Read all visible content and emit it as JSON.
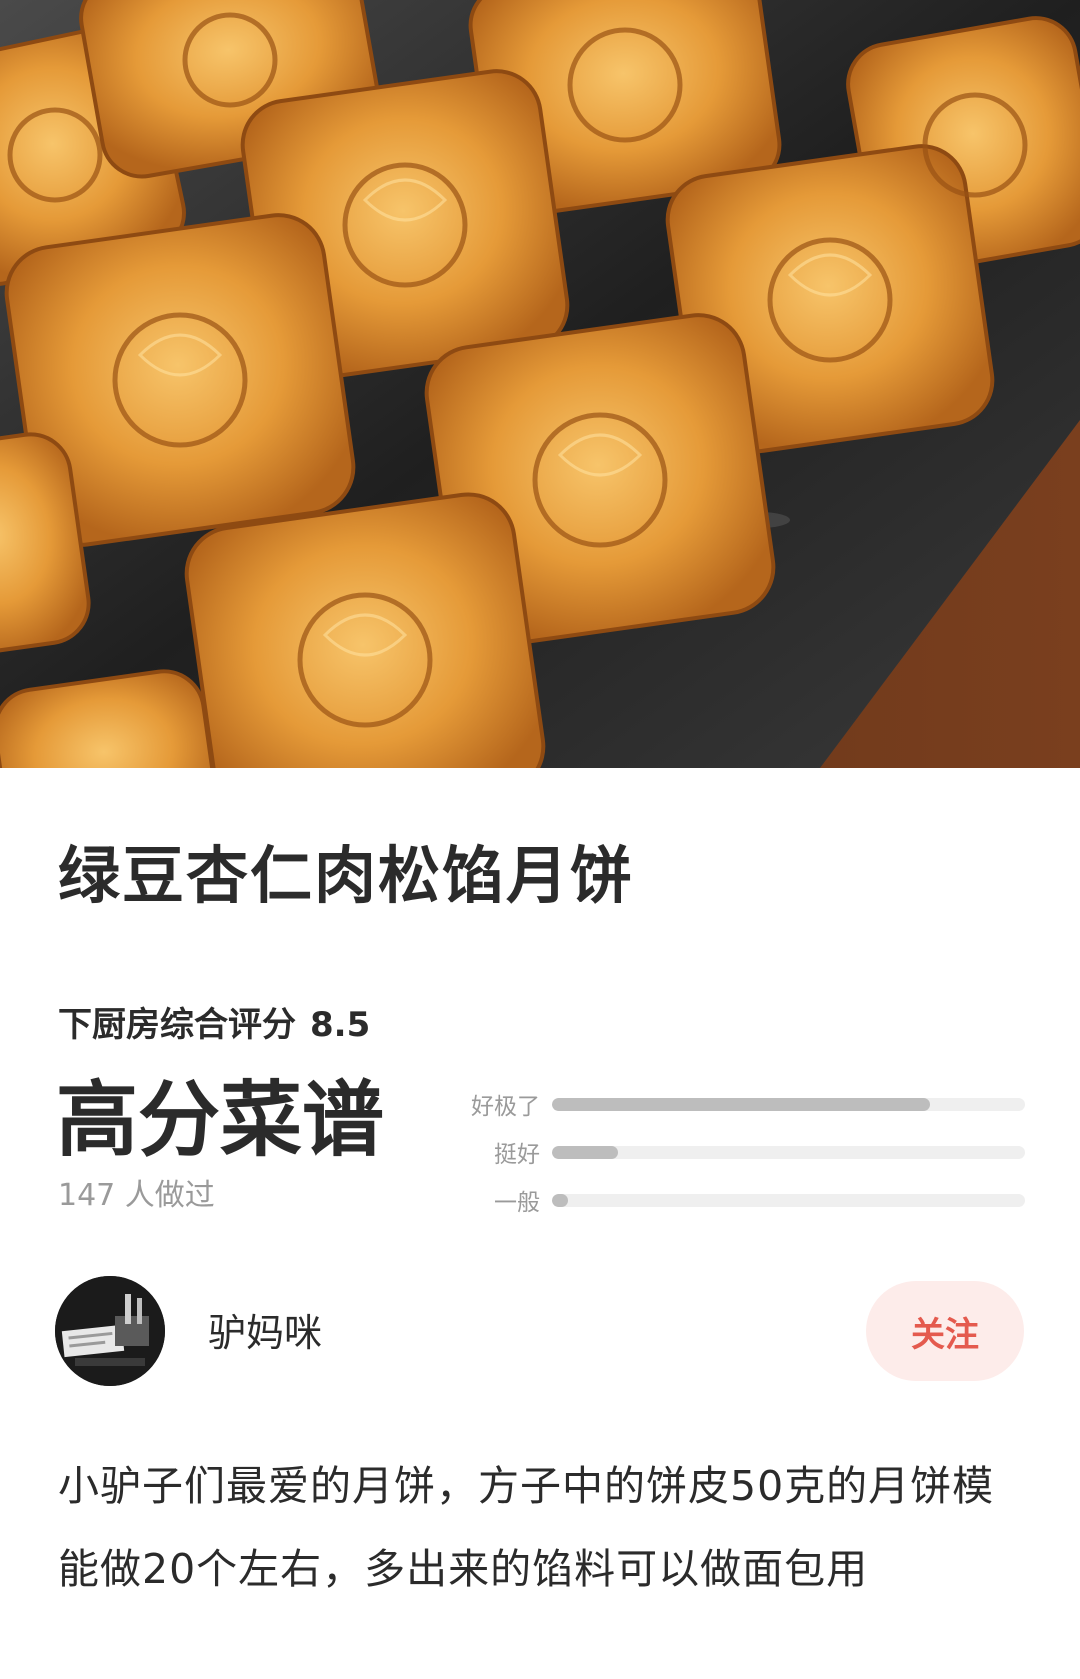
{
  "hero": {
    "image_icon": "mooncake-photo-icon"
  },
  "recipe": {
    "title": "绿豆杏仁肉松馅月饼",
    "score_label": "下厨房综合评分",
    "score_value": "8.5",
    "badge": "高分菜谱",
    "made_count": "147 人做过"
  },
  "rating_bars": [
    {
      "label": "好极了",
      "fraction": 0.8
    },
    {
      "label": "挺好",
      "fraction": 0.14
    },
    {
      "label": "一般",
      "fraction": 0.03
    }
  ],
  "author": {
    "name": "驴妈咪",
    "avatar_icon": "avatar-photo-icon",
    "follow_label": "关注"
  },
  "description": "小驴子们最爱的月饼，方子中的饼皮50克的月饼模能做20个左右，多出来的馅料可以做面包用",
  "colors": {
    "accent": "#e45a4e",
    "follow_bg": "#fdecea",
    "bar_fill": "#bdbdbd",
    "bar_track": "#efefef"
  }
}
